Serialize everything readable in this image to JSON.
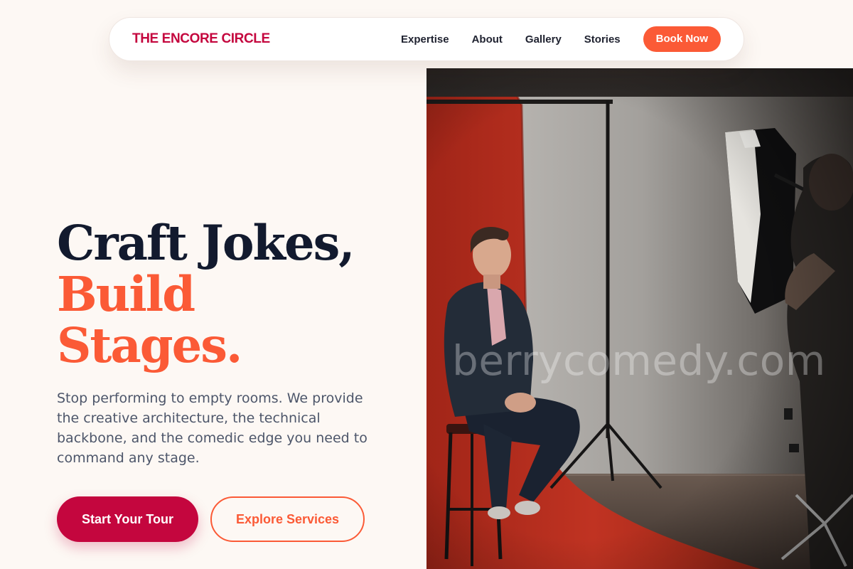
{
  "nav": {
    "brand": "THE ENCORE CIRCLE",
    "links": [
      "Expertise",
      "About",
      "Gallery",
      "Stories"
    ],
    "cta": "Book Now"
  },
  "hero": {
    "headline_line1": "Craft Jokes,",
    "headline_line2": "Build Stages.",
    "description": "Stop performing to empty rooms. We provide the creative architecture, the technical backbone, and the comedic edge you need to command any stage.",
    "primary_button": "Start Your Tour",
    "secondary_button": "Explore Services"
  },
  "image": {
    "watermark": "berrycomedy.com"
  },
  "colors": {
    "background": "#fdf8f4",
    "brand_crimson": "#c4063e",
    "accent_orange": "#fb5a36",
    "headline_dark": "#121a2e",
    "body_text": "#4d566a"
  }
}
